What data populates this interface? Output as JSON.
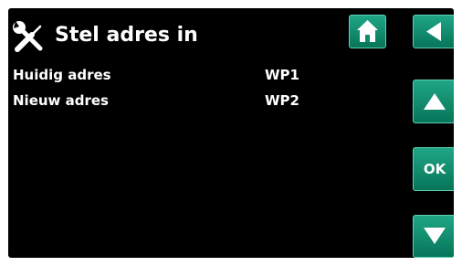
{
  "header": {
    "title": "Stel adres in",
    "icon": "tools-icon"
  },
  "rows": [
    {
      "label": "Huidig adres",
      "value": "WP1"
    },
    {
      "label": "Nieuw adres",
      "value": "WP2"
    }
  ],
  "buttons": {
    "home_icon": "home-icon",
    "back_icon": "back-arrow-icon",
    "up_icon": "up-arrow-icon",
    "ok_label": "OK",
    "down_icon": "down-arrow-icon"
  },
  "colors": {
    "background": "#000000",
    "text": "#ffffff",
    "button_green": "#0e8c6b",
    "button_border": "#5fd1b3"
  }
}
